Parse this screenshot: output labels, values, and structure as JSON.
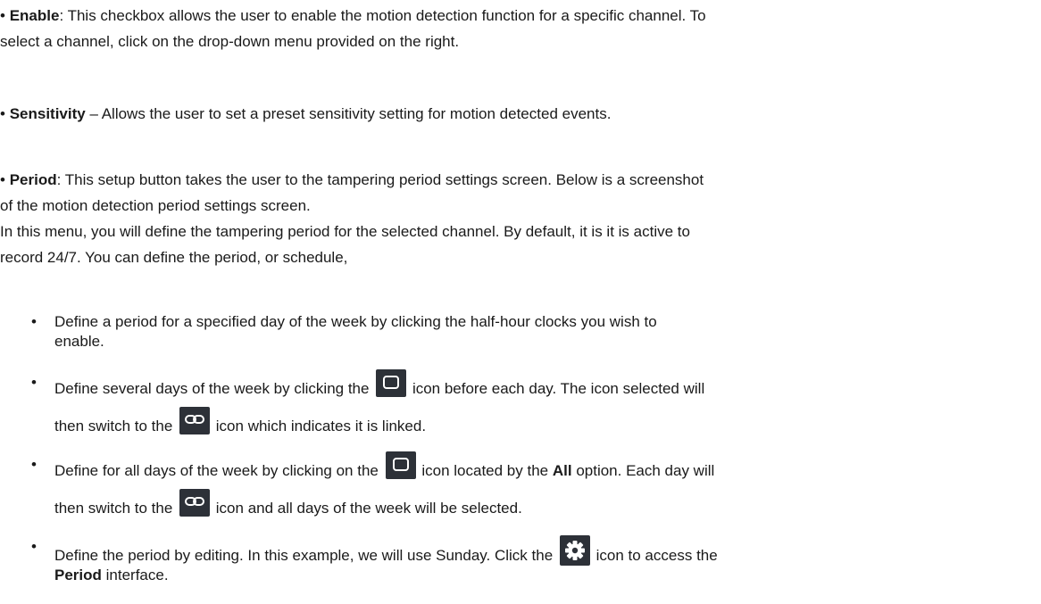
{
  "p1": {
    "bullet": "•",
    "term": "Enable",
    "text_line1": ": This checkbox allows the user to enable the motion detection function for a specific channel. To",
    "text_line2": "select a channel, click on the drop-down menu provided on the right."
  },
  "p2": {
    "bullet": "•",
    "term": "Sensitivity",
    "text": " – Allows the user to set a preset sensitivity setting for motion detected events."
  },
  "p3": {
    "bullet": "•",
    "term": "Period",
    "line1": ": This setup button takes the user to the tampering period settings screen. Below is a screenshot",
    "line2": "of the motion detection period settings screen.",
    "line3": "In this menu, you will define the tampering period for the selected channel. By default, it is it is active to",
    "line4": "record 24/7. You can define the period, or schedule,"
  },
  "list": {
    "bullet": "•",
    "item1": {
      "line1": "Define a period for a specified day of the week by clicking the half-hour clocks you wish to",
      "line2": "enable."
    },
    "item2": {
      "a": "Define several days of the week by clicking the",
      "icon1": "unlinked-square-icon",
      "b": "icon before each day. The icon selected will",
      "c": "then switch to the",
      "icon2": "link-icon",
      "d": "icon which indicates it is linked."
    },
    "item3": {
      "a": "Define for all days of the week by clicking on the",
      "icon1": "unlinked-square-icon",
      "b": "icon located by the",
      "all": "All",
      "c": "option. Each day will",
      "d": "then switch to the",
      "icon2": "link-icon",
      "e": "icon and all days of the week will be selected."
    },
    "item4": {
      "a": "Define the period by editing. In this example, we will use Sunday. Click the",
      "icon": "gear-icon",
      "b": "icon to access the",
      "period": "Period",
      "c": "interface."
    }
  }
}
